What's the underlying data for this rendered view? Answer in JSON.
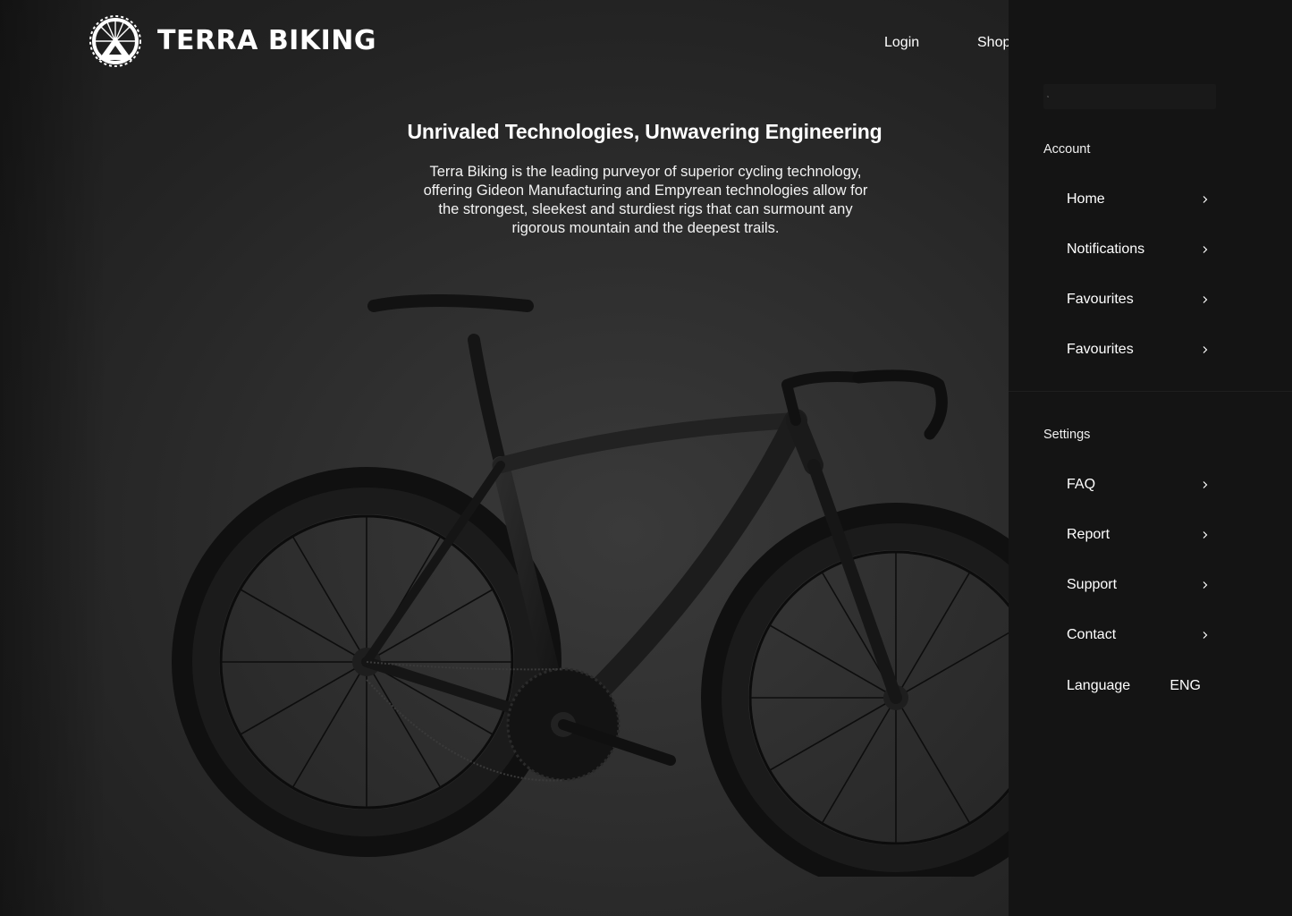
{
  "brand": {
    "name": "TERRA BIKING",
    "logo_icon": "wheel-mountain-logo-icon"
  },
  "nav": {
    "login_label": "Login",
    "shop_label": "Shop"
  },
  "hero": {
    "headline": "Unrivaled Technologies, Unwavering Engineering",
    "intro": "Terra Biking is the leading purveyor of superior cycling technology, offering Gideon Manufacturing and Empyrean technologies allow for the strongest, sleekest and sturdiest rigs that can surmount any rigorous mountain and the deepest trails.",
    "image_subject": "black road bicycle"
  },
  "drawer": {
    "search": {
      "placeholder": "",
      "icon": "search-icon"
    },
    "account": {
      "title": "Account",
      "items": [
        {
          "label": "Home"
        },
        {
          "label": "Notifications"
        },
        {
          "label": "Favourites"
        },
        {
          "label": "Favourites"
        }
      ]
    },
    "settings": {
      "title": "Settings",
      "items": [
        {
          "label": "FAQ"
        },
        {
          "label": "Report"
        },
        {
          "label": "Support"
        },
        {
          "label": "Contact"
        }
      ],
      "language": {
        "label": "Language",
        "value": "ENG"
      }
    }
  },
  "colors": {
    "drawer_bg": "#141414",
    "hero_bg": "#2b2b2b",
    "text": "#ffffff"
  }
}
